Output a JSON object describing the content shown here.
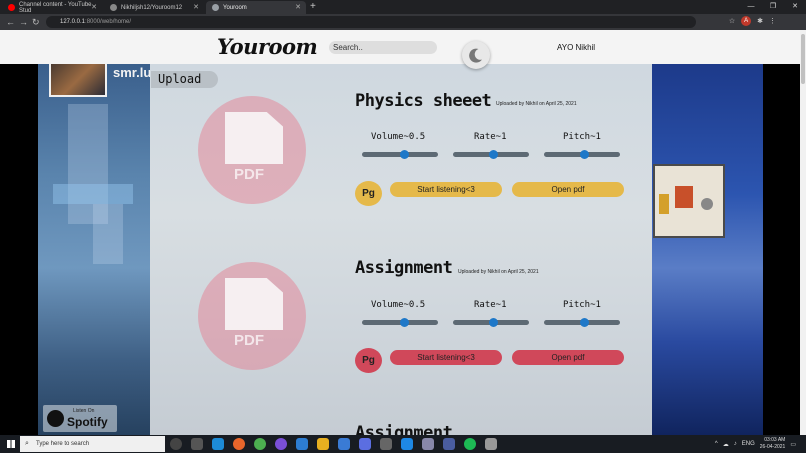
{
  "browser": {
    "tabs": [
      {
        "title": "Channel content - YouTube Stud",
        "favicon_color": "#ff0000"
      },
      {
        "title": "Nikhiljsh12/Youroom12",
        "favicon_color": "#888888"
      },
      {
        "title": "Youroom",
        "favicon_color": "#9aa0a6"
      }
    ],
    "url_host": "127.0.0.1",
    "url_path": ":8000/web/home/"
  },
  "header": {
    "logo": "Youroom",
    "search_placeholder": "Search..",
    "user_name": "AYO Nikhil"
  },
  "sidebar": {
    "profile_name": "smr.lu",
    "upload_label": "Upload",
    "spotify": {
      "listen_label": "Listen On",
      "brand": "Spotify"
    }
  },
  "documents": [
    {
      "title": "Physics sheeet",
      "uploaded_by": "Uploaded by Nikhil on April 25, 2021",
      "volume_label": "Volume~0.5",
      "rate_label": "Rate~1",
      "pitch_label": "Pitch~1",
      "volume": 0.5,
      "rate": 1,
      "pitch": 1,
      "pg_label": "Pg",
      "listen_label": "Start listening<3",
      "open_label": "Open pdf",
      "pdf_label": "PDF",
      "accent": "#e5b94a"
    },
    {
      "title": "Assignment",
      "uploaded_by": "Uploaded by Nikhil on April 25, 2021",
      "volume_label": "Volume~0.5",
      "rate_label": "Rate~1",
      "pitch_label": "Pitch~1",
      "volume": 0.5,
      "rate": 1,
      "pitch": 1,
      "pg_label": "Pg",
      "listen_label": "Start listening<3",
      "open_label": "Open pdf",
      "pdf_label": "PDF",
      "accent": "#d0485a"
    },
    {
      "title": "Assignment"
    }
  ],
  "taskbar": {
    "search_placeholder": "Type here to search",
    "language": "ENG",
    "time": "03:03 AM",
    "date": "26-04-2021"
  },
  "icons": {
    "theme_toggle": "moon-icon",
    "search": "search-icon",
    "spotify": "spotify-icon"
  }
}
